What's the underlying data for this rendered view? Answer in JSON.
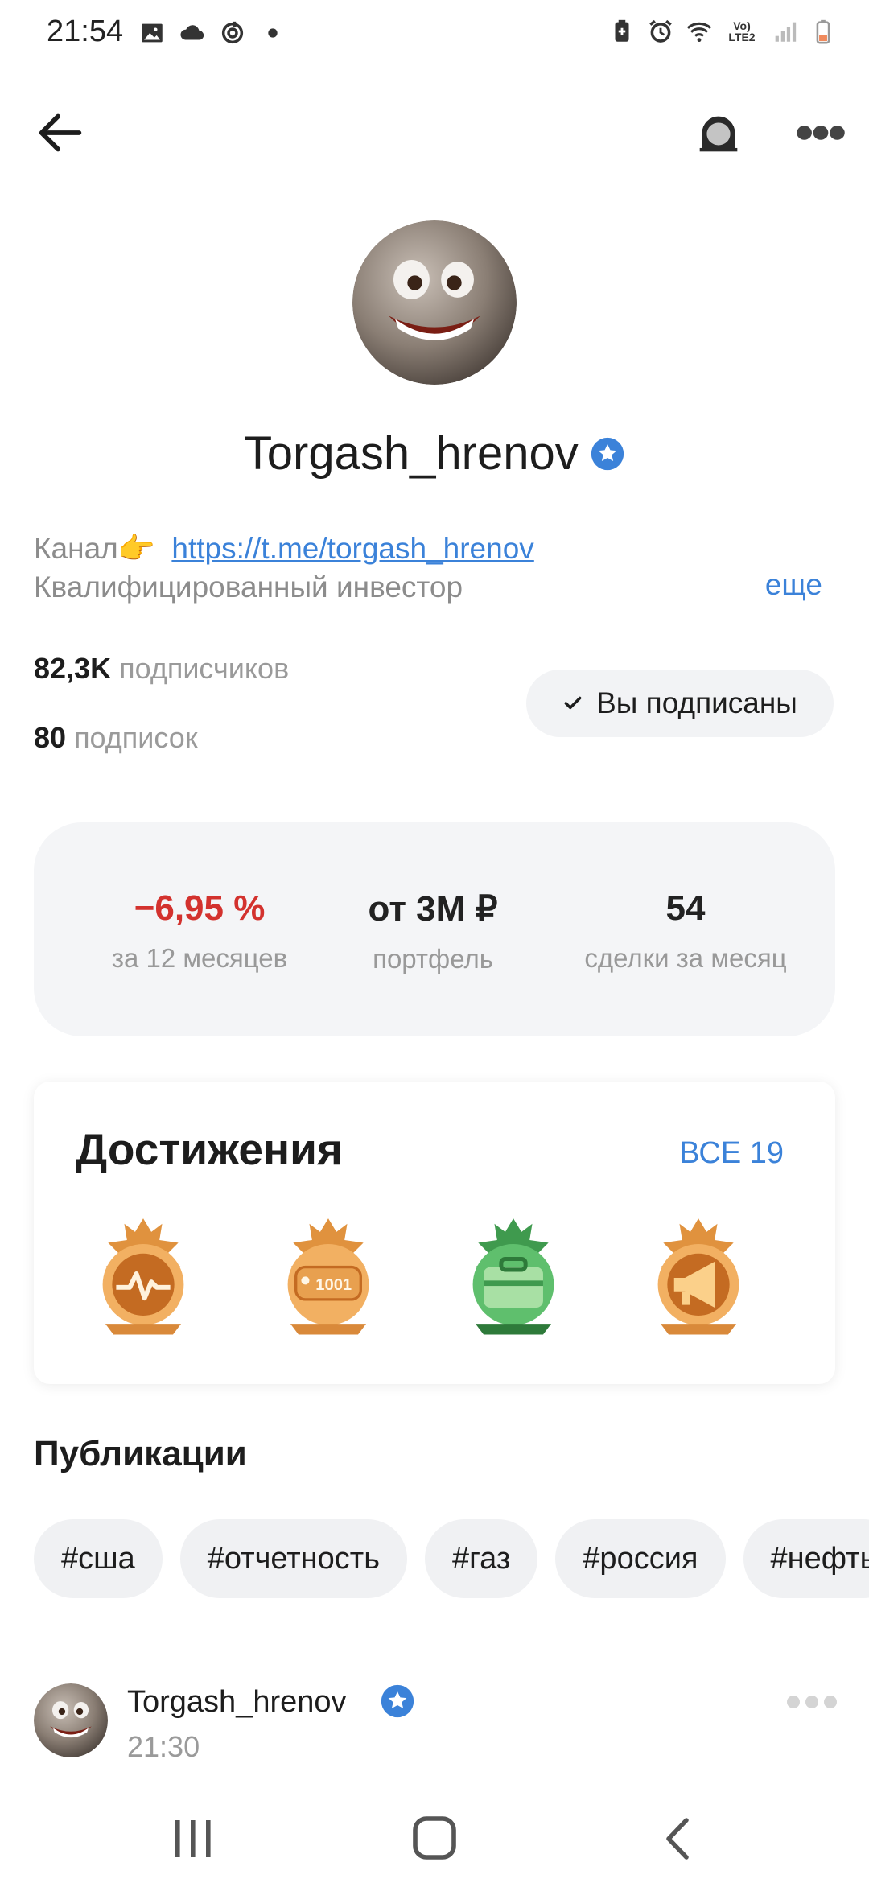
{
  "status_bar": {
    "time": "21:54",
    "left_icons": [
      "image-icon",
      "cloud-icon",
      "sync-icon",
      "dot-icon"
    ],
    "right_icons": [
      "battery-saver-icon",
      "alarm-icon",
      "wifi-icon",
      "volte-icon",
      "signal-icon",
      "battery-icon"
    ],
    "volte_line1": "Vo)",
    "volte_line2": "LTE2"
  },
  "appbar": {
    "icons": [
      "back-arrow-icon",
      "ghost-icon",
      "more-dots-icon"
    ]
  },
  "profile": {
    "name": "Torgash_hrenov",
    "bio_prefix": "Канал👉",
    "bio_link": "https://t.me/torgash_hrenov",
    "bio_line2": "Квалифицированный инвестор",
    "more": "еще",
    "subscribers_count": "82,3K",
    "subscribers_label": "подписчиков",
    "subscriptions_count": "80",
    "subscriptions_label": "подписок",
    "subscribed_button": "Вы подписаны"
  },
  "metrics": [
    {
      "value": "−6,95 %",
      "label": "за 12 месяцев"
    },
    {
      "value": "от 3M ₽",
      "label": "портфель"
    },
    {
      "value": "54",
      "label": "сделки за месяц"
    }
  ],
  "achievements": {
    "title": "Достижения",
    "all": "ВСЕ 19",
    "badge_text": "1001",
    "badges": [
      "pulse-badge-icon",
      "1001-badge-icon",
      "briefcase-badge-icon",
      "megaphone-badge-icon"
    ]
  },
  "publications": {
    "title": "Публикации",
    "tags": [
      "#сша",
      "#отчетность",
      "#газ",
      "#россия",
      "#нефть"
    ]
  },
  "post": {
    "author": "Torgash_hrenov",
    "time": "21:30"
  },
  "colors": {
    "accent": "#3b82d9",
    "negative": "#d3322e",
    "gold": "#d9893a",
    "green": "#3f9a4e"
  }
}
